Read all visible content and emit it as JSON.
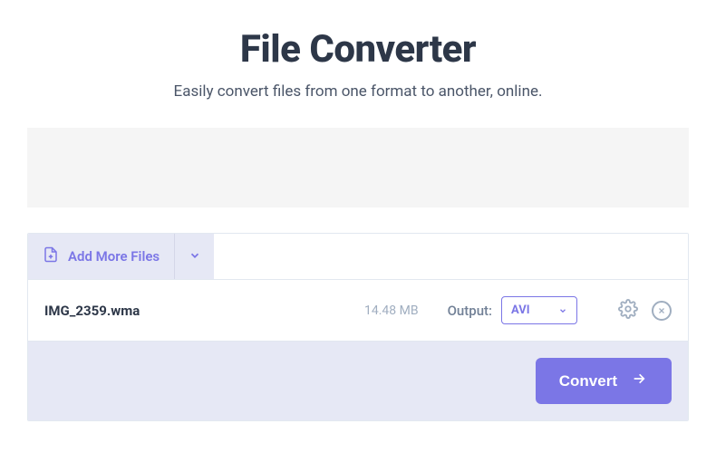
{
  "header": {
    "title": "File Converter",
    "subtitle": "Easily convert files from one format to another, online."
  },
  "toolbar": {
    "add_more_label": "Add More Files"
  },
  "file": {
    "name": "IMG_2359.wma",
    "size": "14.48 MB",
    "output_label": "Output:",
    "output_value": "AVI"
  },
  "actions": {
    "convert_label": "Convert"
  }
}
